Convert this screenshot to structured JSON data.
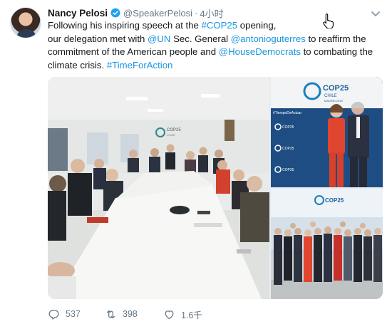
{
  "tweet": {
    "author_name": "Nancy Pelosi",
    "handle": "@SpeakerPelosi",
    "time": "4小时",
    "text": {
      "line1_before": "Following his inspiring speech at the ",
      "hashtag_cop25": "#COP25",
      "line1_after": " opening,",
      "line2_before": "our delegation met with ",
      "mention_un": "@UN",
      "line2_mid": " Sec. General ",
      "mention_guterres": "@antonioguterres",
      "line2_after": " to reaffirm the",
      "line3_before": "commitment of the American people and ",
      "mention_housedems": "@HouseDemocrats",
      "line3_after": " to combating the",
      "line4_before": "climate crisis. ",
      "hashtag_timeforaction": "#TimeForAction"
    },
    "photo_texts": {
      "main_logo_line1": "COP25",
      "main_logo_line2": "CHILE",
      "top_logo_line1": "COP25",
      "top_logo_line2": "CHILE",
      "top_logo_line3": "MADRID 2019",
      "top_banner": "#TiempoDeActuar",
      "tile_label": "COP25",
      "bot_logo": "COP25"
    },
    "actions": {
      "replies": "537",
      "retweets": "398",
      "likes": "1.6千"
    }
  },
  "colors": {
    "link": "#1b95e0",
    "secondary": "#657786",
    "verified": "#1da1f2",
    "cop_blue": "#1f4f86"
  },
  "icons": [
    "verified-badge-icon",
    "caret-down-icon",
    "pointer-cursor-icon",
    "reply-icon",
    "retweet-icon",
    "like-icon"
  ]
}
